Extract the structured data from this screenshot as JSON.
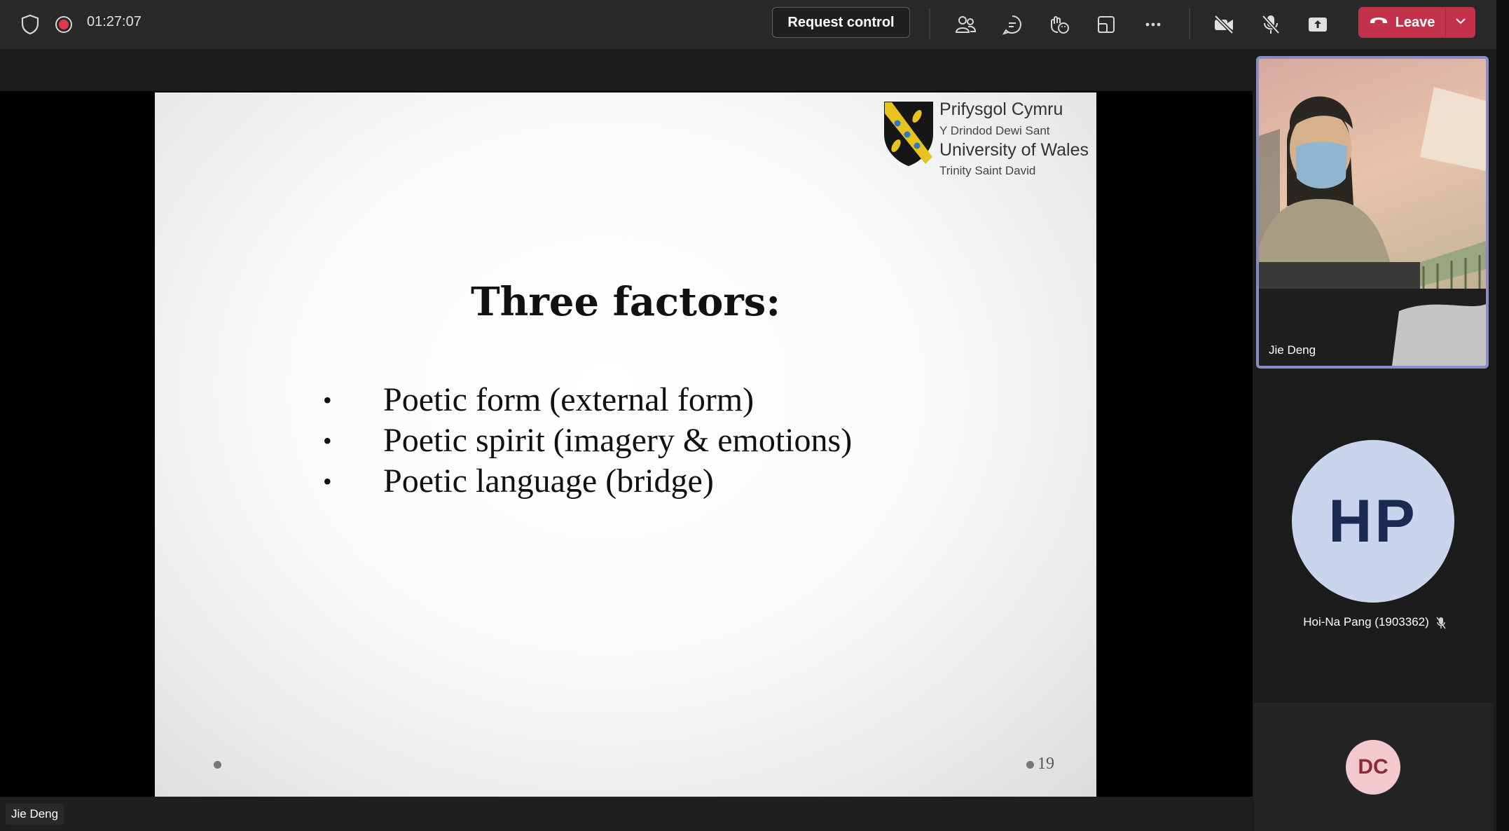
{
  "meeting": {
    "timer": "01:27:07",
    "request_control_label": "Request control",
    "leave_label": "Leave"
  },
  "slide": {
    "logo": {
      "line1": "Prifysgol Cymru",
      "line2": "Y Drindod Dewi Sant",
      "line3": "University of Wales",
      "line4": "Trinity Saint David"
    },
    "title": "Three factors:",
    "bullets": [
      "Poetic form (external form)",
      "Poetic spirit (imagery & emotions)",
      "Poetic language (bridge)"
    ],
    "page_number": "19"
  },
  "presenter_label": "Jie Deng",
  "participants": [
    {
      "name": "Jie Deng",
      "type": "video"
    },
    {
      "name": "Hoi-Na Pang (1903362)",
      "initials": "HP",
      "muted": true
    },
    {
      "initials": "DC"
    }
  ],
  "colors": {
    "topbar_bg": "#292929",
    "leave_red": "#c4314b",
    "active_speaker_border": "#8b8cc7",
    "hp_avatar_bg": "#c9d5ec",
    "dc_avatar_bg": "#f1c9cf"
  },
  "icons": [
    "shield-icon",
    "recording-icon",
    "people-icon",
    "chat-icon",
    "reactions-icon",
    "share-tray-icon",
    "more-icon",
    "camera-off-icon",
    "mic-off-icon",
    "share-icon",
    "phone-icon",
    "chevron-down-icon"
  ]
}
